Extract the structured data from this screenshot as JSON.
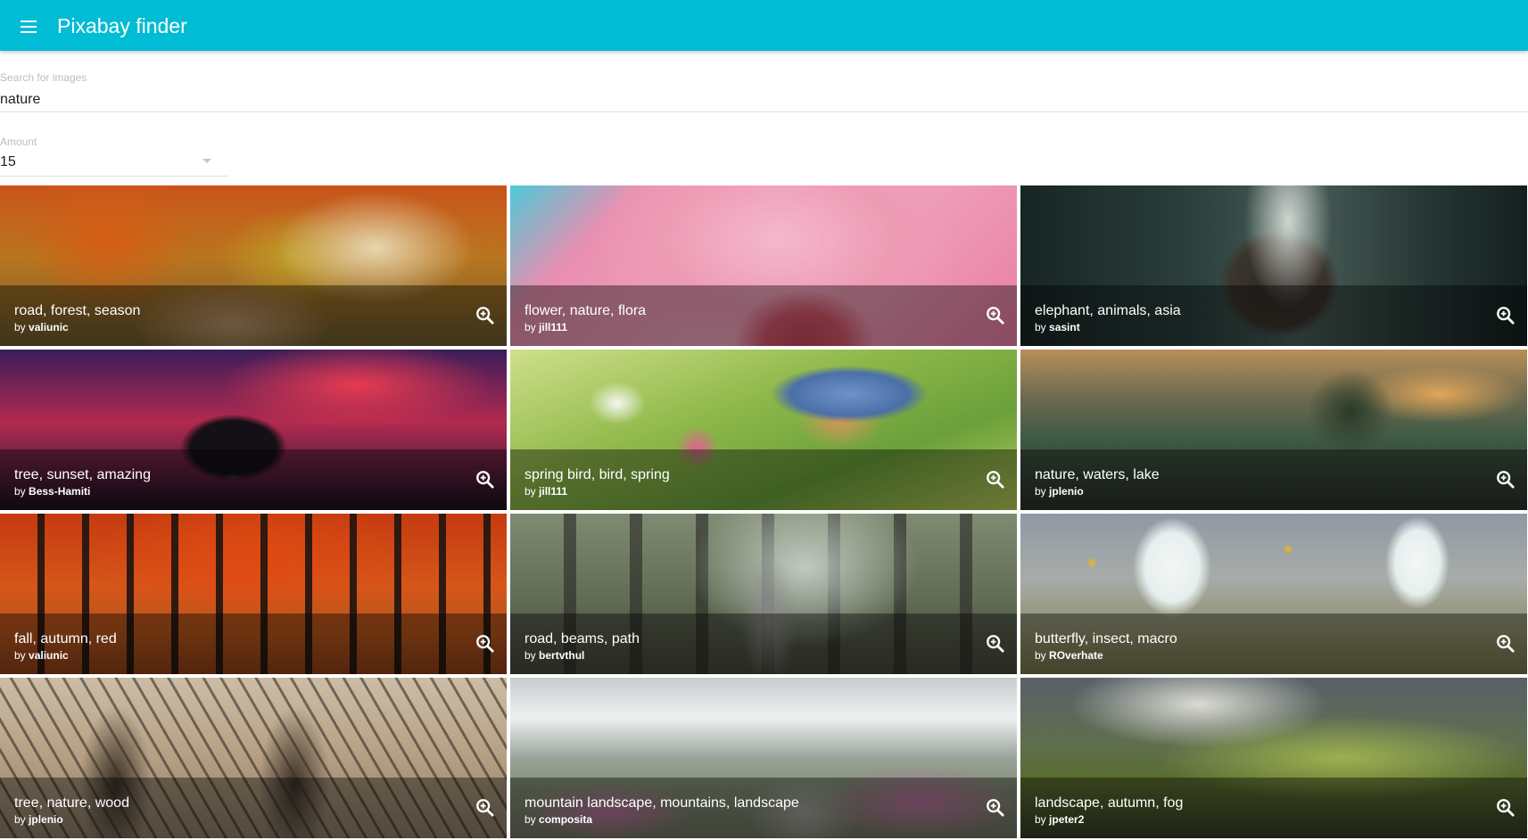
{
  "appbar": {
    "title": "Pixabay finder",
    "menu_icon": "menu-icon",
    "color": "#00bcd4"
  },
  "search": {
    "label": "Search for images",
    "value": "nature"
  },
  "amount": {
    "label": "Amount",
    "value": "15",
    "dropdown_icon": "dropdown-arrow-icon"
  },
  "results": [
    {
      "tags": "road, forest, season",
      "by": "by",
      "author": "valiunic",
      "zoom_icon": "zoom-in-icon"
    },
    {
      "tags": "flower, nature, flora",
      "by": "by",
      "author": "jill111",
      "zoom_icon": "zoom-in-icon"
    },
    {
      "tags": "elephant, animals, asia",
      "by": "by",
      "author": "sasint",
      "zoom_icon": "zoom-in-icon"
    },
    {
      "tags": "tree, sunset, amazing",
      "by": "by",
      "author": "Bess-Hamiti",
      "zoom_icon": "zoom-in-icon"
    },
    {
      "tags": "spring bird, bird, spring",
      "by": "by",
      "author": "jill111",
      "zoom_icon": "zoom-in-icon"
    },
    {
      "tags": "nature, waters, lake",
      "by": "by",
      "author": "jplenio",
      "zoom_icon": "zoom-in-icon"
    },
    {
      "tags": "fall, autumn, red",
      "by": "by",
      "author": "valiunic",
      "zoom_icon": "zoom-in-icon"
    },
    {
      "tags": "road, beams, path",
      "by": "by",
      "author": "bertvthul",
      "zoom_icon": "zoom-in-icon"
    },
    {
      "tags": "butterfly, insect, macro",
      "by": "by",
      "author": "ROverhate",
      "zoom_icon": "zoom-in-icon"
    },
    {
      "tags": "tree, nature, wood",
      "by": "by",
      "author": "jplenio",
      "zoom_icon": "zoom-in-icon"
    },
    {
      "tags": "mountain landscape, mountains, landscape",
      "by": "by",
      "author": "composita",
      "zoom_icon": "zoom-in-icon"
    },
    {
      "tags": "landscape, autumn, fog",
      "by": "by",
      "author": "jpeter2",
      "zoom_icon": "zoom-in-icon"
    }
  ]
}
